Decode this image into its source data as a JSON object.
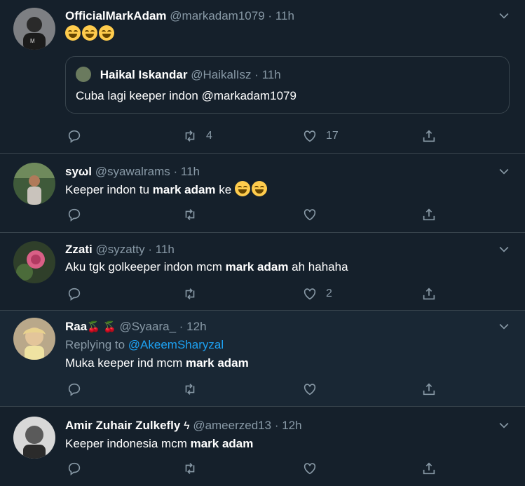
{
  "tweets": [
    {
      "name": "OfficialMarkAdam",
      "handle": "@markadam1079",
      "time": "11h",
      "text_emoji_count": 3,
      "quote": {
        "name": "Haikal Iskandar",
        "handle": "@HaikalIsz",
        "time": "11h",
        "text": "Cuba lagi keeper indon @markadam1079"
      },
      "retweets": "4",
      "likes": "17"
    },
    {
      "name": "syωl",
      "handle": "@syawalrams",
      "time": "11h",
      "text_before": "Keeper indon tu ",
      "text_bold": "mark adam",
      "text_after": " ke ",
      "retweets": "",
      "likes": ""
    },
    {
      "name": "Zzati",
      "handle": "@syzatty",
      "time": "11h",
      "text_before": "Aku tgk golkeeper indon mcm ",
      "text_bold": "mark adam",
      "text_after": " ah hahaha",
      "retweets": "",
      "likes": "2"
    },
    {
      "name": "Raa",
      "name_emoji": "🍒 🍒",
      "handle": "@Syaara_",
      "time": "12h",
      "replying_label": "Replying to",
      "replying_to": "@AkeemSharyzal",
      "text_before": "Muka keeper ind mcm ",
      "text_bold": "mark adam",
      "text_after": "",
      "retweets": "",
      "likes": ""
    },
    {
      "name": "Amir Zuhair Zulkefly",
      "name_emoji": "ϟ",
      "handle": "@ameerzed13",
      "time": "12h",
      "text_before": "Keeper indonesia mcm ",
      "text_bold": "mark adam",
      "text_after": "",
      "retweets": "",
      "likes": ""
    }
  ],
  "separator": "·",
  "icons": [
    "reply-icon",
    "retweet-icon",
    "like-icon",
    "share-icon",
    "caret-down-icon"
  ],
  "colors": {
    "background": "#15202b",
    "highlight": "#192734",
    "muted": "#8899a6",
    "link": "#1da1f2",
    "border": "#38444d"
  }
}
